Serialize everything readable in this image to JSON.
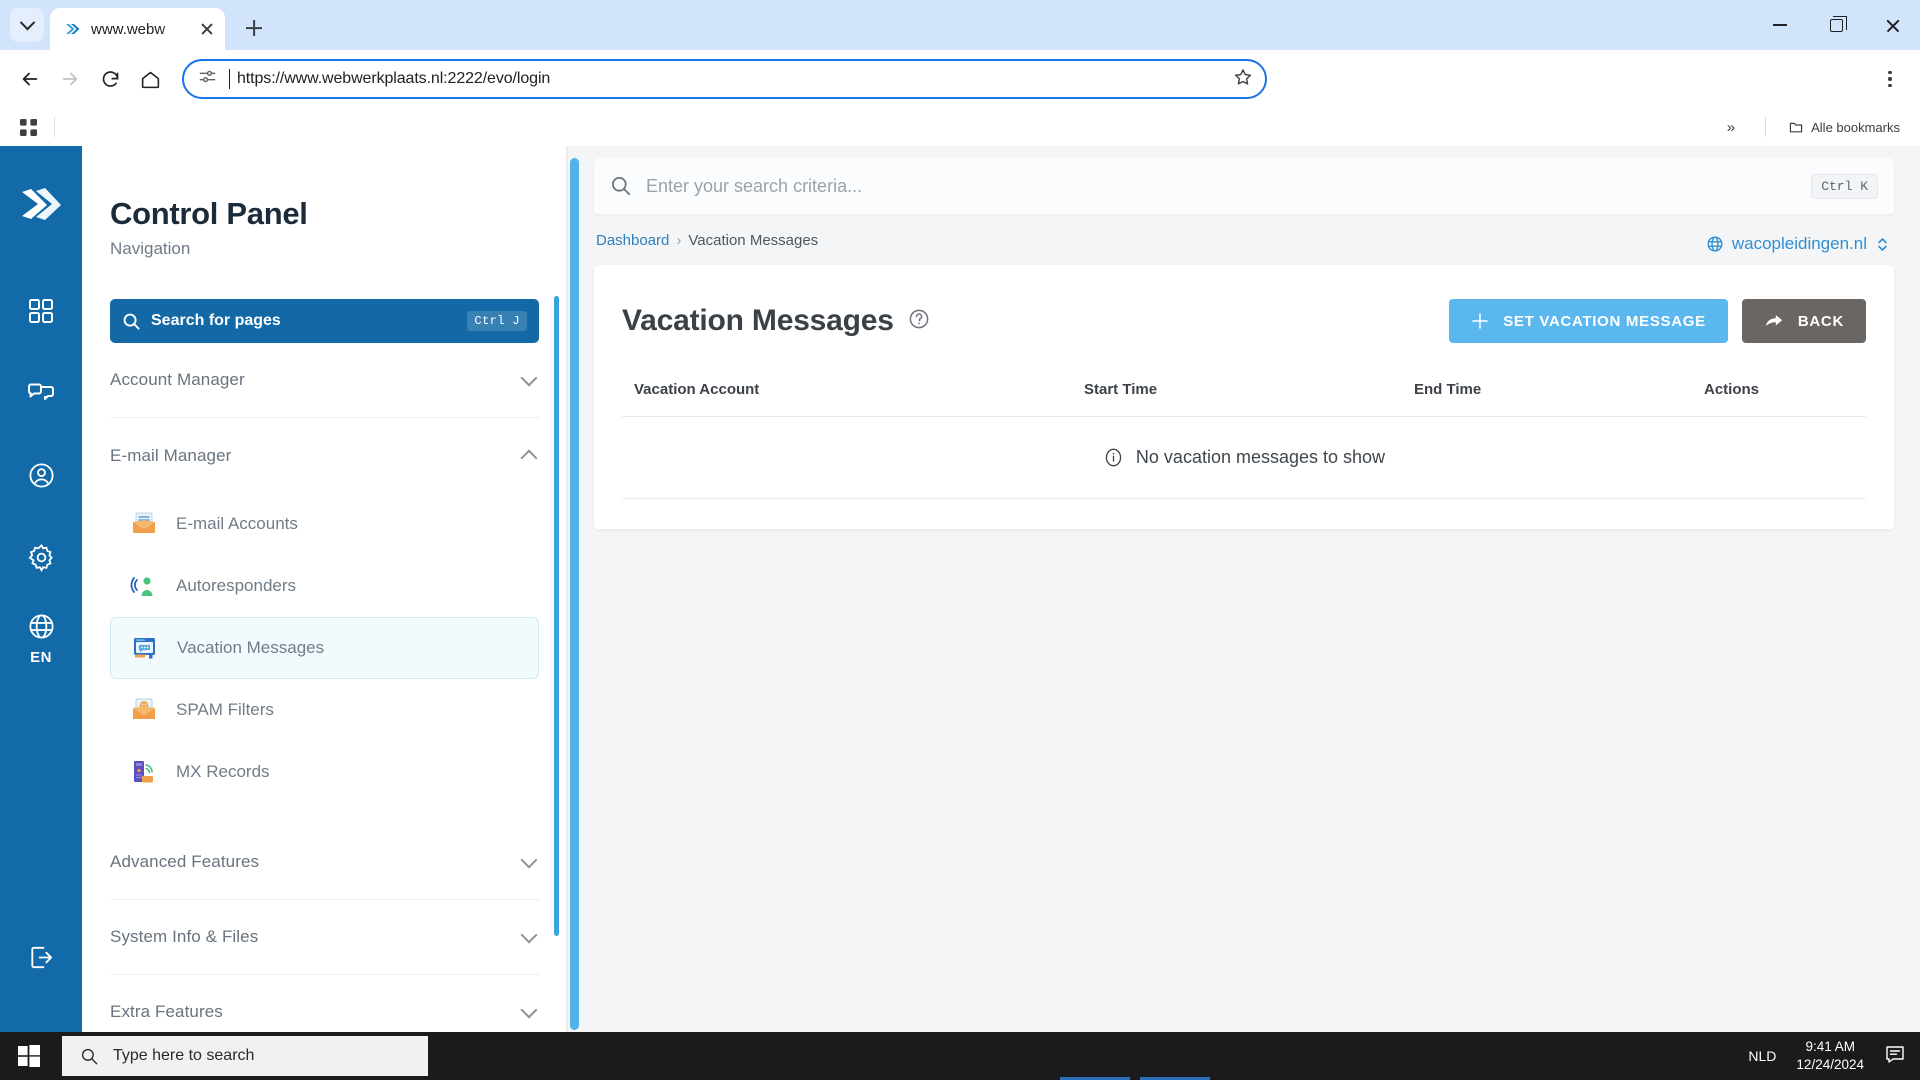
{
  "browser": {
    "tab": {
      "title": "www.webw",
      "favicon": "double-chevron-icon"
    },
    "url": "https://www.webwerkplaats.nl:2222/evo/login",
    "bookmarks_all_label": "Alle bookmarks",
    "overflow_label": "»"
  },
  "rail": {
    "logo": "double-chevron-logo",
    "items": [
      {
        "name": "grid-icon",
        "label": ""
      },
      {
        "name": "chat-icon",
        "label": ""
      },
      {
        "name": "user-icon",
        "label": ""
      },
      {
        "name": "gear-icon",
        "label": ""
      }
    ],
    "language": {
      "icon": "globe-icon",
      "label": "EN"
    },
    "logout": {
      "icon": "logout-icon"
    }
  },
  "sidebar": {
    "title": "Control Panel",
    "subtitle": "Navigation",
    "search": {
      "label": "Search for pages",
      "shortcut": "Ctrl J",
      "icon": "search-icon"
    },
    "groups": [
      {
        "label": "Account Manager",
        "expanded": false
      },
      {
        "label": "E-mail Manager",
        "expanded": true
      },
      {
        "label": "Advanced Features",
        "expanded": false
      },
      {
        "label": "System Info & Files",
        "expanded": false
      },
      {
        "label": "Extra Features",
        "expanded": false
      }
    ],
    "email_items": [
      {
        "label": "E-mail Accounts",
        "icon": "open-envelope-icon",
        "active": false
      },
      {
        "label": "Autoresponders",
        "icon": "broadcast-person-icon",
        "active": false
      },
      {
        "label": "Vacation Messages",
        "icon": "monitor-message-icon",
        "active": true
      },
      {
        "label": "SPAM Filters",
        "icon": "envelope-smiley-icon",
        "active": false
      },
      {
        "label": "MX Records",
        "icon": "server-signal-icon",
        "active": false
      }
    ]
  },
  "main": {
    "search": {
      "placeholder": "Enter your search criteria...",
      "shortcut": "Ctrl K",
      "icon": "search-icon"
    },
    "breadcrumb": {
      "root": "Dashboard",
      "separator": "›",
      "current": "Vacation Messages"
    },
    "domain_selector": {
      "label": "wacopleidingen.nl",
      "icon": "globe-icon"
    },
    "page_title": "Vacation Messages",
    "help_icon": "question-circle-icon",
    "buttons": {
      "primary": {
        "label": "SET VACATION MESSAGE",
        "icon": "plus-icon",
        "color": "#5ab8ee"
      },
      "back": {
        "label": "BACK",
        "icon": "arrow-right-curve-icon",
        "color": "#696663"
      }
    },
    "table": {
      "headers": [
        "Vacation Account",
        "Start Time",
        "End Time",
        "Actions"
      ],
      "rows": [],
      "empty_message": "No vacation messages to show",
      "empty_icon": "info-circle-icon"
    }
  },
  "taskbar": {
    "start_icon": "windows-logo",
    "search_placeholder": "Type here to search",
    "search_icon": "search-icon",
    "language": "NLD",
    "time": "9:41 AM",
    "date": "12/24/2024",
    "notification_icon": "notifications-icon"
  },
  "colors": {
    "rail_blue": "#136aa8",
    "accent_blue": "#1269a5",
    "primary_button": "#5ab8ee",
    "back_button": "#696663",
    "link_blue": "#2f7fba"
  }
}
